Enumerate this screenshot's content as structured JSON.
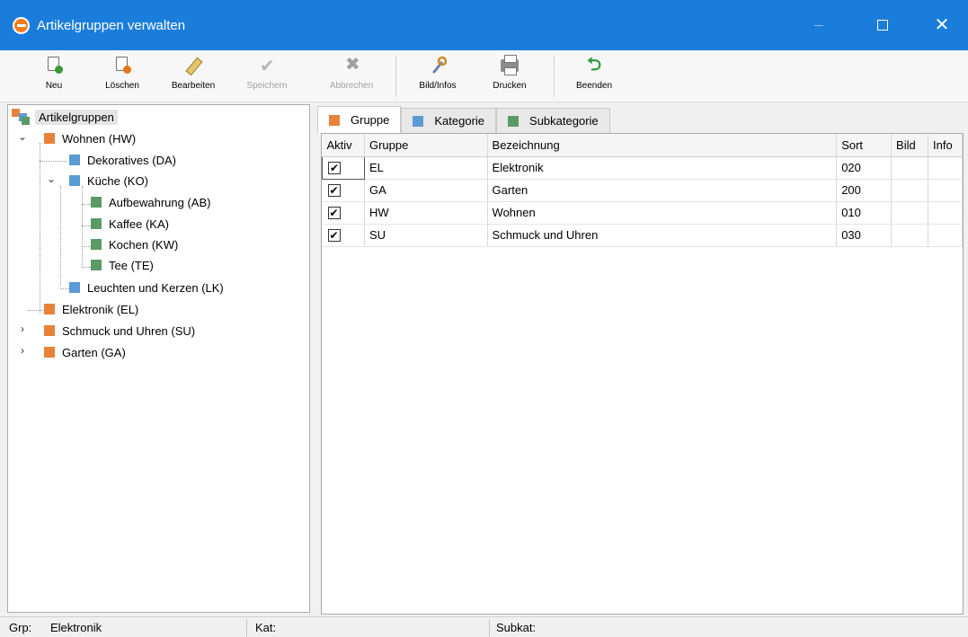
{
  "window": {
    "title": "Artikelgruppen verwalten",
    "close_glyph": "✕"
  },
  "toolbar": {
    "new_label": "Neu",
    "delete_label": "Löschen",
    "edit_label": "Bearbeiten",
    "save_label": "Speichern",
    "cancel_label": "Abbrechen",
    "image_info_label": "Bild/Infos",
    "print_label": "Drucken",
    "exit_label": "Beenden"
  },
  "tree": {
    "root": "Artikelgruppen",
    "nodes": [
      {
        "label": "Wohnen  (HW)",
        "type": "gruppe",
        "expanded": true
      },
      {
        "label": "Dekoratives  (DA)",
        "type": "kategorie"
      },
      {
        "label": "Küche  (KO)",
        "type": "kategorie",
        "expanded": true
      },
      {
        "label": "Aufbewahrung  (AB)",
        "type": "subkategorie"
      },
      {
        "label": "Kaffee  (KA)",
        "type": "subkategorie"
      },
      {
        "label": "Kochen  (KW)",
        "type": "subkategorie"
      },
      {
        "label": "Tee  (TE)",
        "type": "subkategorie"
      },
      {
        "label": "Leuchten und Kerzen  (LK)",
        "type": "kategorie"
      },
      {
        "label": "Elektronik  (EL)",
        "type": "gruppe"
      },
      {
        "label": "Schmuck und Uhren  (SU)",
        "type": "gruppe",
        "expanded": false
      },
      {
        "label": "Garten  (GA)",
        "type": "gruppe",
        "expanded": false
      }
    ],
    "expanded_glyph": "⌄",
    "collapsed_glyph": "›"
  },
  "tabs": [
    {
      "label": "Gruppe",
      "active": true
    },
    {
      "label": "Kategorie",
      "active": false
    },
    {
      "label": "Subkategorie",
      "active": false
    }
  ],
  "grid": {
    "columns": [
      "Aktiv",
      "Gruppe",
      "Bezeichnung",
      "Sort",
      "Bild",
      "Info"
    ],
    "check_glyph": "✔",
    "rows": [
      {
        "aktiv": true,
        "gruppe": "EL",
        "bezeichnung": "Elektronik",
        "sort": "020",
        "bild": "",
        "info": ""
      },
      {
        "aktiv": true,
        "gruppe": "GA",
        "bezeichnung": "Garten",
        "sort": "200",
        "bild": "",
        "info": ""
      },
      {
        "aktiv": true,
        "gruppe": "HW",
        "bezeichnung": "Wohnen",
        "sort": "010",
        "bild": "",
        "info": ""
      },
      {
        "aktiv": true,
        "gruppe": "SU",
        "bezeichnung": "Schmuck und Uhren",
        "sort": "030",
        "bild": "",
        "info": ""
      }
    ]
  },
  "status": {
    "grp_label": "Grp:",
    "grp_value": "Elektronik",
    "kat_label": "Kat:",
    "kat_value": "",
    "subkat_label": "Subkat:",
    "subkat_value": ""
  },
  "colors": {
    "titlebar": "#1b7ddb",
    "gruppe": "#e8823a",
    "kategorie": "#5b9bd5",
    "subkategorie": "#5a9a66"
  }
}
